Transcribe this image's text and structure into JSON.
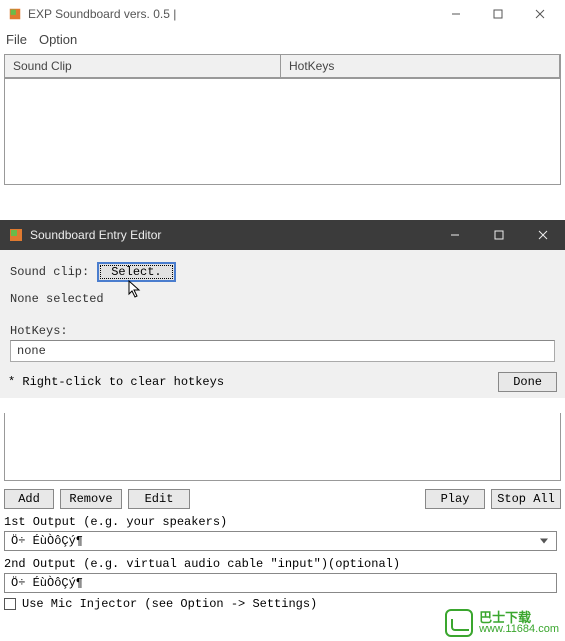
{
  "main": {
    "title": "EXP Soundboard vers. 0.5 |",
    "menu": {
      "file": "File",
      "option": "Option"
    },
    "headers": {
      "clip": "Sound Clip",
      "hotkeys": "HotKeys"
    },
    "buttons": {
      "add": "Add",
      "remove": "Remove",
      "edit": "Edit",
      "play": "Play",
      "stopall": "Stop All"
    },
    "out1_label": "1st Output (e.g. your speakers)",
    "out1_value": "Ö÷ ÉùÒôÇý¶",
    "out2_label": "2nd Output (e.g. virtual audio cable \"input\")(optional)",
    "out2_value": "Ö÷ ÉùÒôÇý¶",
    "mic_label": "Use Mic Injector (see Option -> Settings)"
  },
  "dialog": {
    "title": "Soundboard Entry Editor",
    "soundclip_label": "Sound clip:",
    "select_btn": "Select.",
    "none_selected": "None selected",
    "hotkeys_label": "HotKeys:",
    "hotkeys_value": "none",
    "clear_note": "* Right-click to clear hotkeys",
    "done_btn": "Done"
  },
  "watermark": {
    "top": "巴士下载",
    "bot": "www.11684.com"
  }
}
